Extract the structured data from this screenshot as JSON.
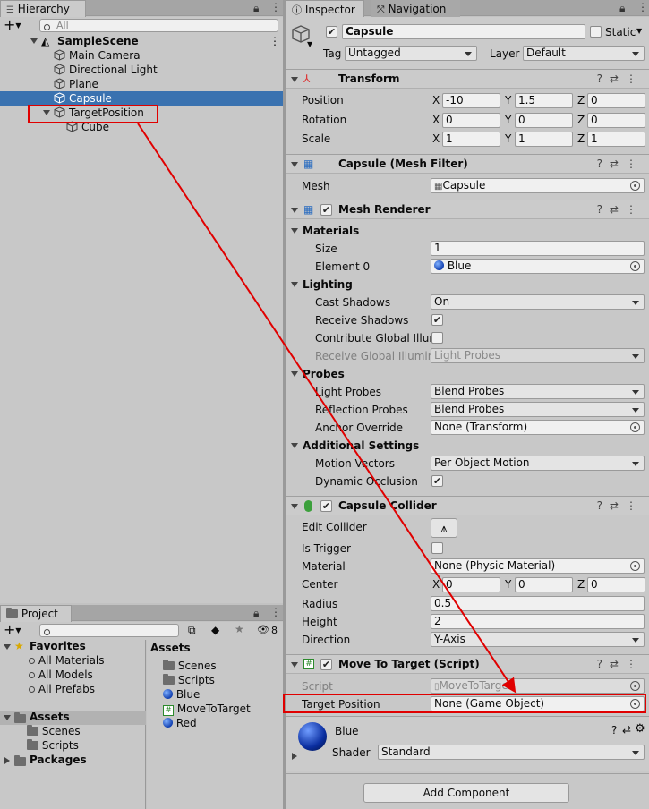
{
  "hierarchy": {
    "tab_label": "Hierarchy",
    "search_placeholder": "All",
    "items": [
      {
        "label": "SampleScene"
      },
      {
        "label": "Main Camera"
      },
      {
        "label": "Directional Light"
      },
      {
        "label": "Plane"
      },
      {
        "label": "Capsule"
      },
      {
        "label": "TargetPosition"
      },
      {
        "label": "Cube"
      }
    ]
  },
  "project": {
    "tab_label": "Project",
    "hidden_count": "8",
    "favorites": {
      "label": "Favorites",
      "items": [
        "All Materials",
        "All Models",
        "All Prefabs"
      ]
    },
    "assets_tree": {
      "label": "Assets",
      "items": [
        "Scenes",
        "Scripts"
      ]
    },
    "packages_label": "Packages",
    "assets_header": "Assets",
    "assets_list": [
      "Scenes",
      "Scripts",
      "Blue",
      "MoveToTarget",
      "Red"
    ]
  },
  "inspector": {
    "tab_inspector": "Inspector",
    "tab_navigation": "Navigation",
    "object_name": "Capsule",
    "static_label": "Static",
    "tag_label": "Tag",
    "tag_value": "Untagged",
    "layer_label": "Layer",
    "layer_value": "Default",
    "transform": {
      "title": "Transform",
      "position_label": "Position",
      "position": [
        "-10",
        "1.5",
        "0"
      ],
      "rotation_label": "Rotation",
      "rotation": [
        "0",
        "0",
        "0"
      ],
      "scale_label": "Scale",
      "scale": [
        "1",
        "1",
        "1"
      ],
      "axes": [
        "X",
        "Y",
        "Z"
      ]
    },
    "mesh_filter": {
      "title": "Capsule (Mesh Filter)",
      "mesh_label": "Mesh",
      "mesh_value": "Capsule"
    },
    "mesh_renderer": {
      "title": "Mesh Renderer",
      "materials_label": "Materials",
      "size_label": "Size",
      "size_value": "1",
      "element0_label": "Element 0",
      "element0_value": "Blue",
      "lighting_label": "Lighting",
      "cast_shadows_label": "Cast Shadows",
      "cast_shadows_value": "On",
      "receive_shadows_label": "Receive Shadows",
      "contribute_gi_label": "Contribute Global Illum",
      "receive_gi_label": "Receive Global Illumina",
      "receive_gi_value": "Light Probes",
      "probes_label": "Probes",
      "light_probes_label": "Light Probes",
      "light_probes_value": "Blend Probes",
      "reflection_probes_label": "Reflection Probes",
      "reflection_probes_value": "Blend Probes",
      "anchor_override_label": "Anchor Override",
      "anchor_override_value": "None (Transform)",
      "additional_label": "Additional Settings",
      "motion_vectors_label": "Motion Vectors",
      "motion_vectors_value": "Per Object Motion",
      "dynamic_occlusion_label": "Dynamic Occlusion"
    },
    "capsule_collider": {
      "title": "Capsule Collider",
      "edit_collider_label": "Edit Collider",
      "is_trigger_label": "Is Trigger",
      "material_label": "Material",
      "material_value": "None (Physic Material)",
      "center_label": "Center",
      "center": [
        "0",
        "0",
        "0"
      ],
      "radius_label": "Radius",
      "radius_value": "0.5",
      "height_label": "Height",
      "height_value": "2",
      "direction_label": "Direction",
      "direction_value": "Y-Axis"
    },
    "move_to_target": {
      "title": "Move To Target (Script)",
      "script_label": "Script",
      "script_value": "MoveToTarget",
      "target_label": "Target Position",
      "target_value": "None (Game Object)"
    },
    "material": {
      "name": "Blue",
      "shader_label": "Shader",
      "shader_value": "Standard"
    },
    "add_component": "Add Component"
  },
  "colors": {
    "selection": "#3a72b0",
    "annotation": "#e00000"
  }
}
